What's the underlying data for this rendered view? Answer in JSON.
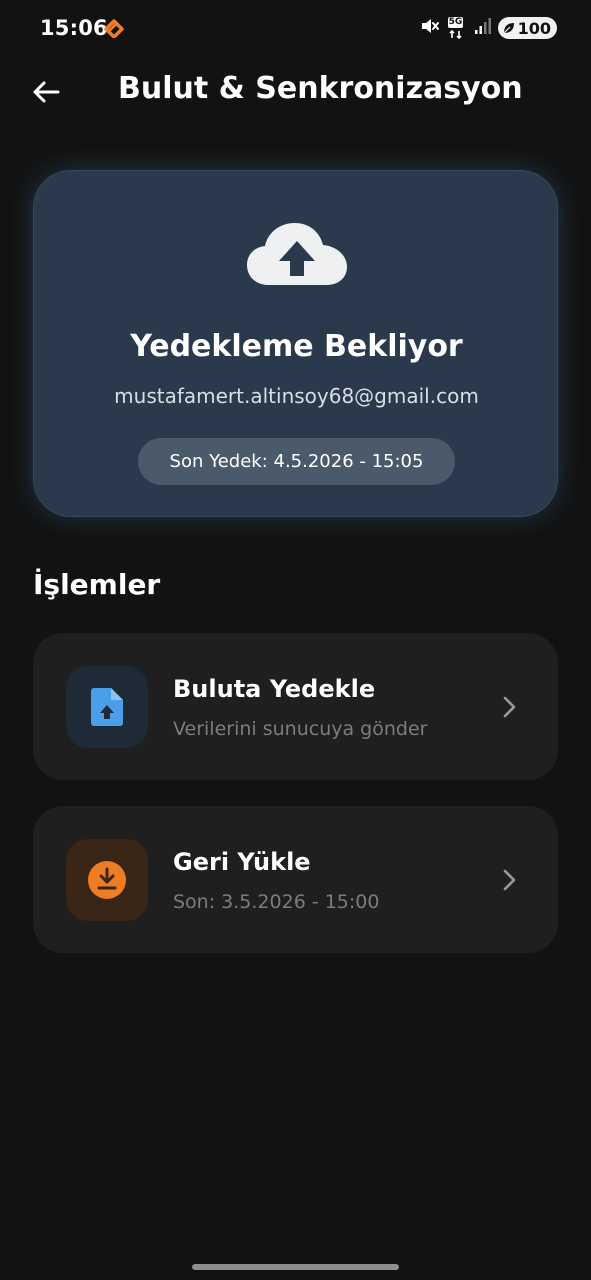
{
  "status_bar": {
    "time": "15:06",
    "network_label": "5G",
    "battery": "100",
    "icons": [
      "app-notification-icon",
      "mute-icon",
      "network-5g-icon",
      "signal-icon",
      "battery-icon"
    ]
  },
  "app_bar": {
    "back_icon": "arrow-left-icon",
    "title": "Bulut & Senkronizasyon"
  },
  "status_card": {
    "icon": "cloud-upload-icon",
    "title": "Yedekleme Bekliyor",
    "email": "mustafamert.altinsoy68@gmail.com",
    "last_backup": "Son Yedek: 4.5.2026 - 15:05",
    "color": "#2a3a4c"
  },
  "actions": {
    "section_title": "İşlemler",
    "items": [
      {
        "icon": "file-upload-icon",
        "title": "Buluta Yedekle",
        "subtitle": "Verilerini sunucuya gönder",
        "icon_color": "#4a9eea"
      },
      {
        "icon": "download-icon",
        "title": "Geri Yükle",
        "subtitle": "Son: 3.5.2026 - 15:00",
        "icon_color": "#f07d22"
      }
    ]
  }
}
